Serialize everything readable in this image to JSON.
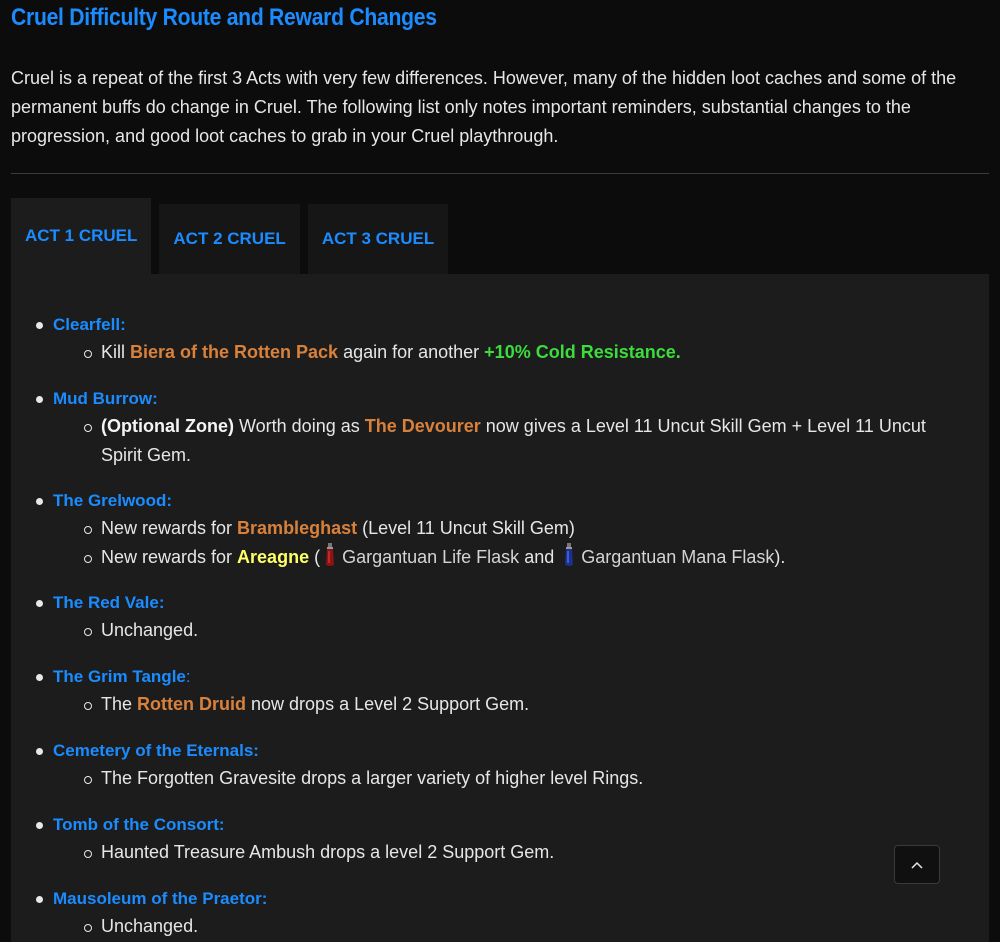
{
  "title": "Cruel Difficulty Route and Reward Changes",
  "intro": "Cruel is a repeat of the first 3 Acts with very few differences. However, many of the hidden loot caches and some of the permanent buffs do change in Cruel. The following list only notes important reminders, substantial changes to the progression, and good loot caches to grab in your Cruel playthrough.",
  "tabs": [
    {
      "label": "ACT 1 CRUEL",
      "active": true
    },
    {
      "label": "ACT 2 CRUEL",
      "active": false
    },
    {
      "label": "ACT 3 CRUEL",
      "active": false
    }
  ],
  "zones": {
    "clearfell": {
      "title": "Clearfell:",
      "s1": {
        "a": "Kill ",
        "b": "Biera of the Rotten Pack",
        "c": " again for another ",
        "d": "+10% Cold Resistance."
      }
    },
    "mud_burrow": {
      "title": "Mud Burrow:",
      "s1": {
        "a": "(Optional Zone)",
        "b": " Worth doing as ",
        "c": "The Devourer",
        "d": " now gives a Level 11 Uncut Skill Gem + Level 11 Uncut Spirit Gem."
      }
    },
    "grelwood": {
      "title": "The Grelwood:",
      "s1": {
        "a": "New rewards for ",
        "b": "Brambleghast",
        "c": " (Level 11 Uncut Skill Gem)"
      },
      "s2": {
        "a": "New rewards for ",
        "b": "Areagne",
        "c": " (",
        "d": "Gargantuan Life Flask",
        "e": " and ",
        "f": "Gargantuan Mana Flask",
        "g": ")."
      }
    },
    "red_vale": {
      "title": "The Red Vale:",
      "s1": "Unchanged."
    },
    "grim_tangle": {
      "title": "The Grim Tangle",
      "colon": ":",
      "s1": {
        "a": "The ",
        "b": "Rotten Druid",
        "c": " now drops a Level 2 Support Gem."
      }
    },
    "cemetery": {
      "title": "Cemetery of the Eternals:",
      "s1": "The Forgotten Gravesite drops a larger variety of higher level Rings."
    },
    "tomb": {
      "title": "Tomb of the Consort:",
      "s1": "Haunted Treasure Ambush drops a level 2 Support Gem."
    },
    "mausoleum": {
      "title": "Mausoleum of the Praetor:",
      "s1": "Unchanged."
    }
  },
  "icons": {
    "life_flask": "life-flask-icon",
    "mana_flask": "mana-flask-icon",
    "scroll_top": "chevron-up-icon"
  },
  "colors": {
    "link_blue": "#1a8cff",
    "orange": "#d9813a",
    "green": "#3bdc3b",
    "yellow": "#ffff66"
  }
}
